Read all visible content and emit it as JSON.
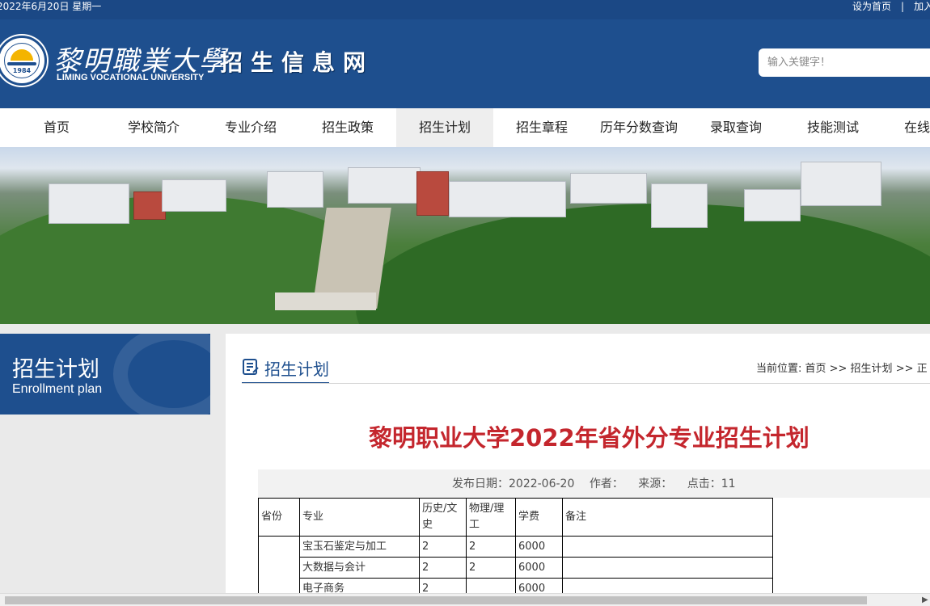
{
  "topbar": {
    "date": "2022年6月20日  星期一",
    "set_home": "设为首页",
    "separator": "|",
    "add_fav": "加入"
  },
  "header": {
    "logo_year": "1984",
    "school_name_cn": "黎明職業大學",
    "school_name_en": "LIMING VOCATIONAL UNIVERSITY",
    "site_title": "招生信息网",
    "search_placeholder": "输入关键字！"
  },
  "nav": {
    "items": [
      {
        "label": "首页"
      },
      {
        "label": "学校简介"
      },
      {
        "label": "专业介绍"
      },
      {
        "label": "招生政策"
      },
      {
        "label": "招生计划",
        "active": true
      },
      {
        "label": "招生章程"
      },
      {
        "label": "历年分数查询"
      },
      {
        "label": "录取查询"
      },
      {
        "label": "技能测试"
      },
      {
        "label": "在线"
      }
    ]
  },
  "sidebar": {
    "title_cn": "招生计划",
    "title_en": "Enrollment plan"
  },
  "content": {
    "section_title": "招生计划",
    "breadcrumb": "当前位置: 首页 >> 招生计划 >> 正",
    "article_title": "黎明职业大学2022年省外分专业招生计划",
    "meta": {
      "date": "发布日期：2022-06-20",
      "author": "作者：",
      "source": "来源：",
      "clicks": "点击：11"
    },
    "table": {
      "headers": [
        "省份",
        "专业",
        "历史/文史",
        "物理/理工",
        "学费",
        "备注"
      ],
      "rows": [
        [
          "",
          "宝玉石鉴定与加工",
          "2",
          "2",
          "6000",
          ""
        ],
        [
          "",
          "大数据与会计",
          "2",
          "2",
          "6000",
          ""
        ],
        [
          "",
          "电子商务",
          "2",
          "",
          "6000",
          ""
        ]
      ]
    }
  },
  "colors": {
    "brand_blue": "#1e4f8e",
    "title_red": "#c4262d",
    "topbar_blue": "#1b4885"
  }
}
